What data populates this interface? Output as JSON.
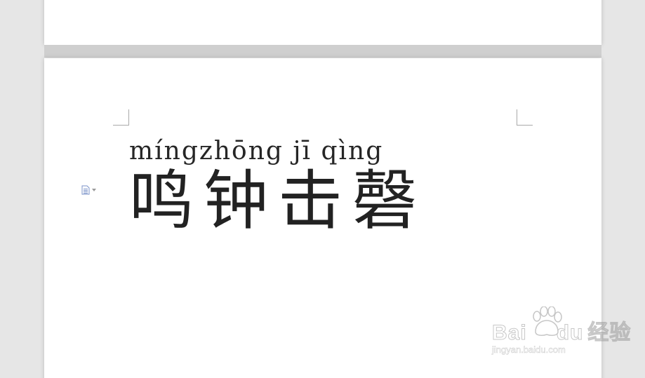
{
  "document": {
    "pinyin": "míngzhōng jī qìng",
    "characters": "鸣钟击磬"
  },
  "paragraph_marker": {
    "icon": "paragraph-doc-icon",
    "dropdown_icon": "triangle-down-icon"
  },
  "watermark": {
    "logo": "Bai du 经验",
    "url": "jingyan.baidu.com"
  },
  "colors": {
    "background": "#e6e6e6",
    "page": "#ffffff",
    "text": "#222222",
    "icon": "#7b93c9"
  }
}
